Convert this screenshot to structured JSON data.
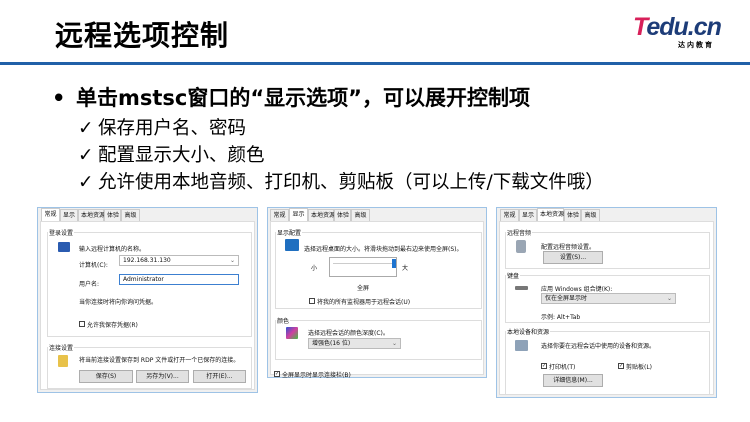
{
  "slide": {
    "title": "远程选项控制",
    "bullet": "单击mstsc窗口的“显示选项”，可以展开控制项",
    "checks": [
      "保存用户名、密码",
      "配置显示大小、颜色",
      "允许使用本地音频、打印机、剪贴板（可以上传/下载文件哦）"
    ]
  },
  "logo": {
    "text_a": "T",
    "text_b": "edu.cn",
    "sub": "达内教育"
  },
  "tabs": [
    "常规",
    "显示",
    "本地资源",
    "体验",
    "高级"
  ],
  "panel1": {
    "group1": "登录设置",
    "prompt": "输入远程计算机的名称。",
    "computer_label": "计算机(C):",
    "computer_value": "192.168.31.130",
    "user_label": "用户名:",
    "user_value": "Administrator",
    "note": "当你连接时将向你询问凭据。",
    "save_cred": "允许我保存凭据(R)",
    "group2": "连接设置",
    "conn_text": "将当前连接设置保存到 RDP 文件或打开一个已保存的连接。",
    "save": "保存(S)",
    "save_as": "另存为(V)...",
    "open": "打开(E)..."
  },
  "panel2": {
    "group1": "显示配置",
    "prompt": "选择远程桌面的大小。将滑块拖动到最右边来使用全屏(S)。",
    "small": "小",
    "large": "大",
    "fullscreen": "全屏",
    "all_monitors": "将我的所有监视器用于远程会话(U)",
    "group2": "颜色",
    "color_prompt": "选择远程会话的颜色深度(C)。",
    "color_value": "增强色(16 位)",
    "show_bar": "全屏显示时显示连接栏(B)",
    "slider_fraction": 1.0
  },
  "panel3": {
    "group1": "远程音频",
    "audio_text": "配置远程音频设置。",
    "settings": "设置(S)...",
    "group2": "键盘",
    "kbd_text": "应用 Windows 组合键(K):",
    "kbd_value": "仅在全屏显示时",
    "example": "示例: Alt+Tab",
    "group3": "本地设备和资源",
    "dev_text": "选择你要在远程会话中使用的设备和资源。",
    "printer": "打印机(T)",
    "clipboard": "剪贴板(L)",
    "details": "详细信息(M)..."
  },
  "check_mark": "✓",
  "bullet_dot": "•",
  "checked_mark": "✓",
  "chevron": "⌄"
}
